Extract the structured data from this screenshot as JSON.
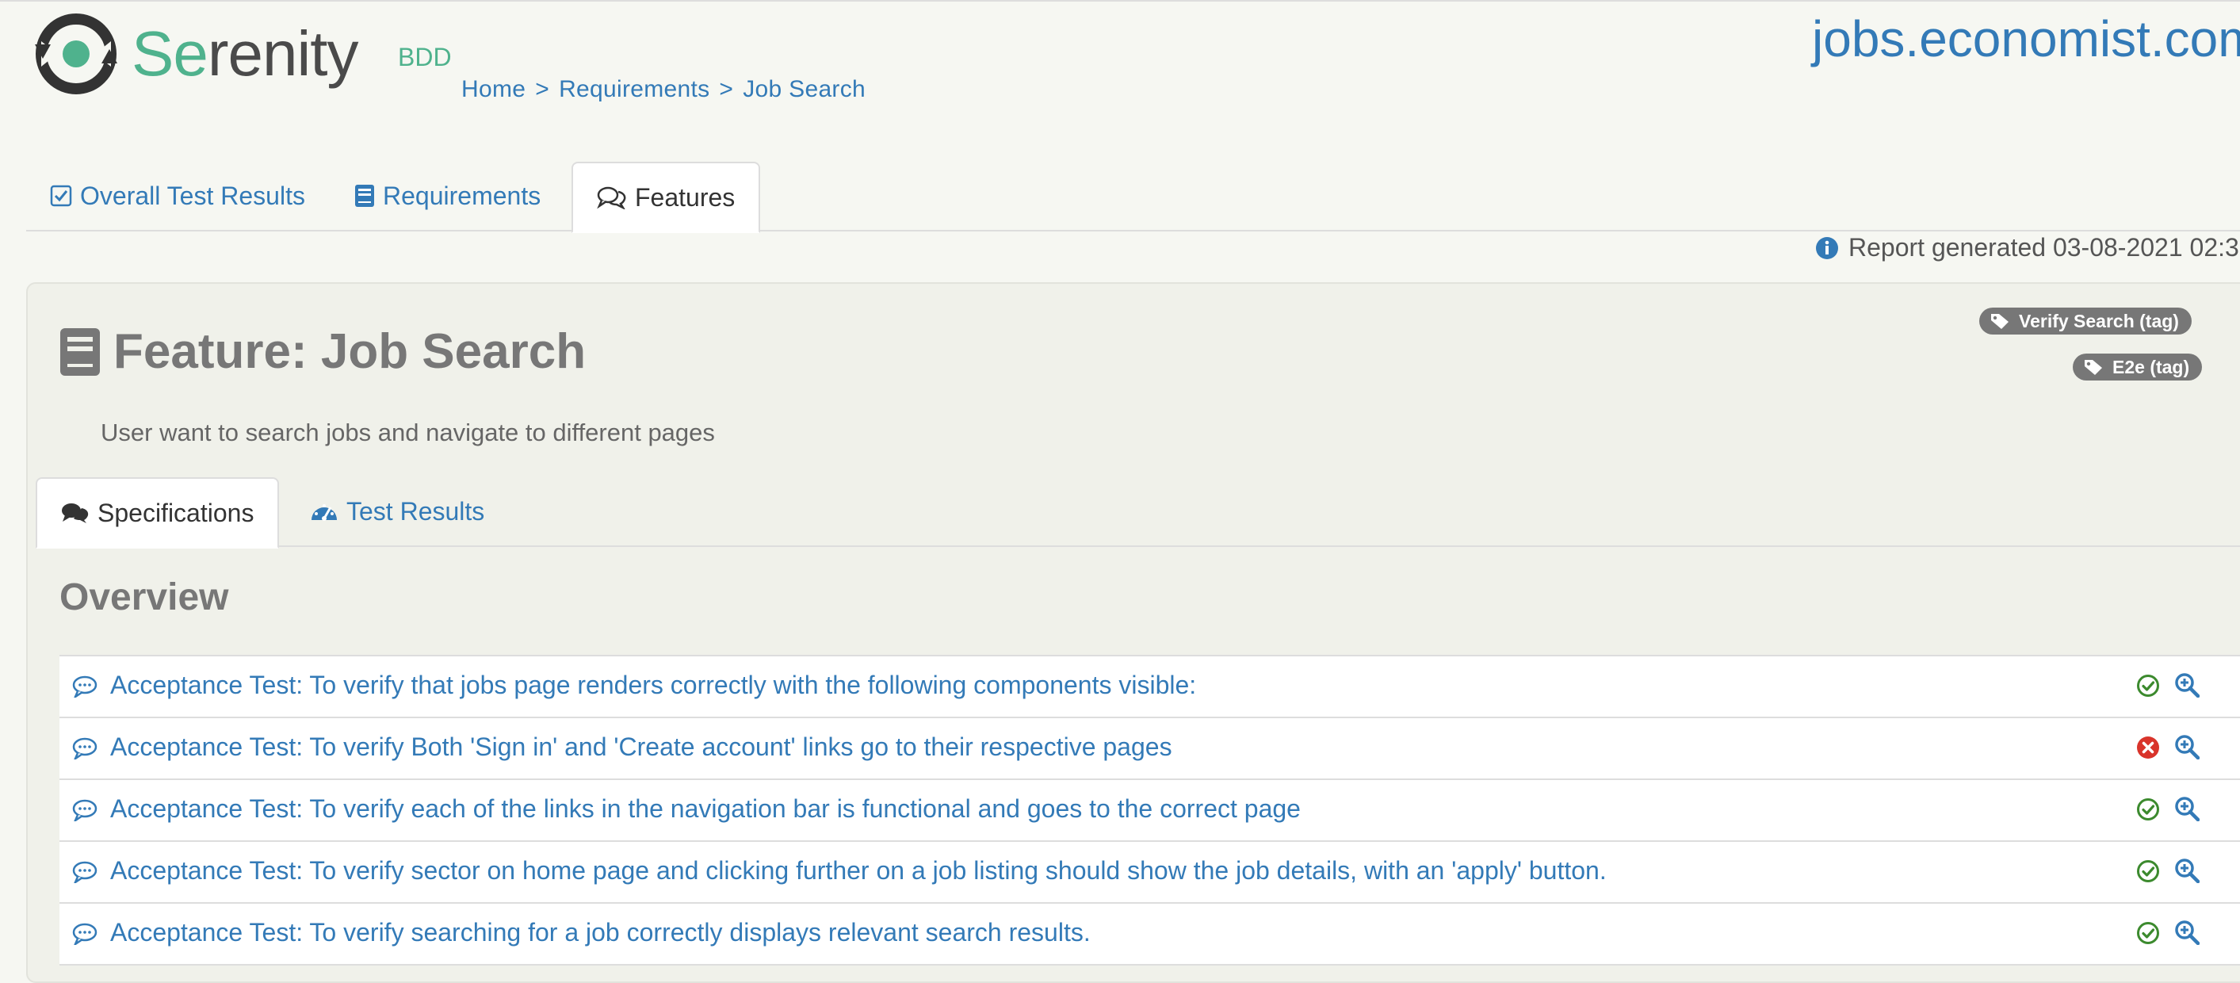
{
  "logo": {
    "word_se": "Se",
    "word_rest": "renity",
    "bdd": "BDD"
  },
  "breadcrumb": {
    "home": "Home",
    "sep1": ">",
    "requirements": "Requirements",
    "sep2": ">",
    "current": "Job Search"
  },
  "site_title": "jobs.economist.com",
  "main_tabs": [
    {
      "label": "Overall Test Results",
      "icon": "checkbox-icon"
    },
    {
      "label": "Requirements",
      "icon": "book-icon"
    },
    {
      "label": "Features",
      "icon": "comments-icon",
      "active": true
    }
  ],
  "report": {
    "text": "Report generated 03-08-2021 02:3",
    "icon": "info-icon"
  },
  "feature": {
    "title": "Feature: Job Search",
    "description": "User want to search jobs and navigate to different pages",
    "tags": [
      "Verify Search (tag)",
      "E2e (tag)"
    ]
  },
  "sub_tabs": [
    {
      "label": "Specifications",
      "icon": "comments-icon",
      "active": true
    },
    {
      "label": "Test Results",
      "icon": "dashboard-icon"
    }
  ],
  "overview_heading": "Overview",
  "specs": [
    {
      "title": "Acceptance Test: To verify that jobs page renders correctly with the following components visible:",
      "status": "passed"
    },
    {
      "title": "Acceptance Test: To verify Both 'Sign in' and 'Create account' links go to their respective pages",
      "status": "failed"
    },
    {
      "title": "Acceptance Test: To verify each of the links in the navigation bar is functional and goes to the correct page",
      "status": "passed"
    },
    {
      "title": "Acceptance Test: To verify sector on home page and clicking further on a job listing should show the job details, with an 'apply' button.",
      "status": "passed"
    },
    {
      "title": "Acceptance Test: To verify searching for a job correctly displays relevant search results.",
      "status": "passed"
    }
  ],
  "colors": {
    "link": "#337ab7",
    "passed": "#3c8a2e",
    "failed": "#d9342b",
    "tag": "#777777",
    "brand": "#4fb28d"
  }
}
